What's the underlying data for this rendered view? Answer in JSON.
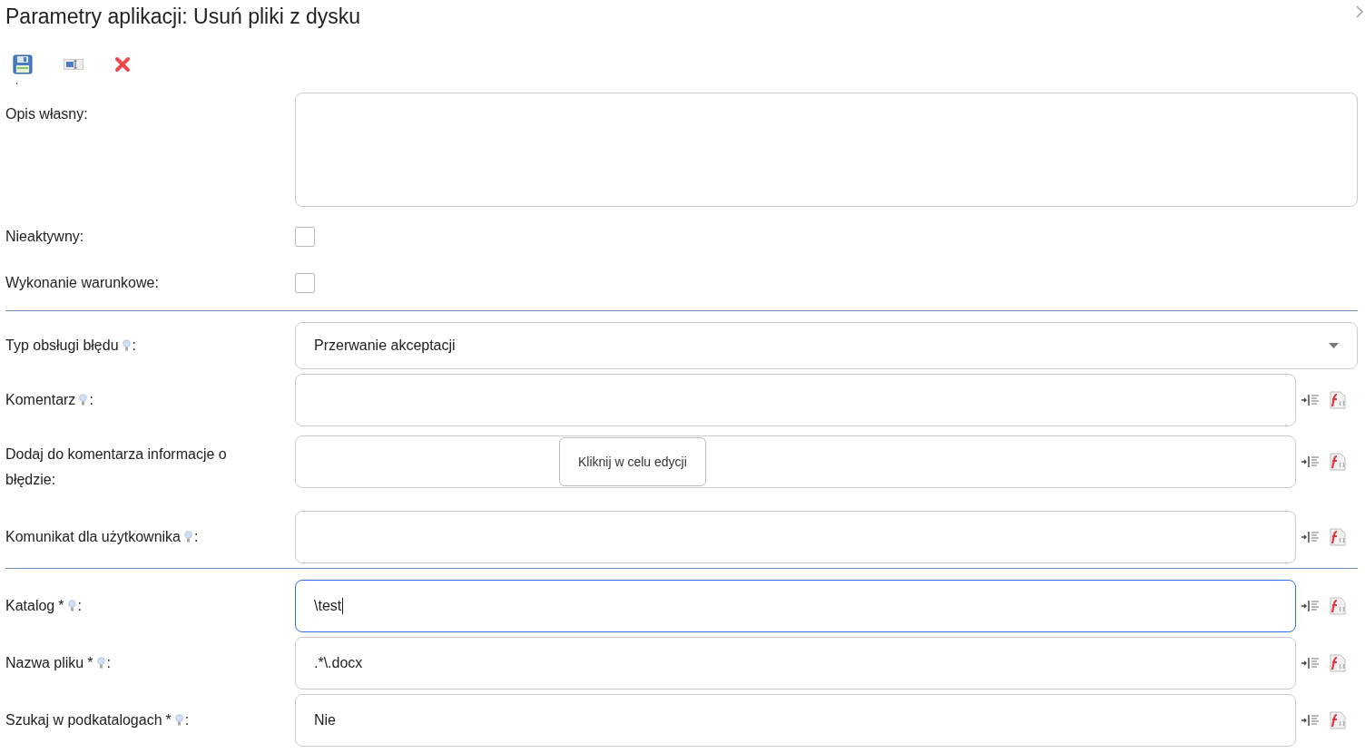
{
  "title": "Parametry aplikacji: Usuń pliki z dysku",
  "toolbar": [
    {
      "kind": "save"
    },
    {
      "kind": "field"
    },
    {
      "kind": "delete"
    }
  ],
  "marker": ".",
  "sections": [
    {
      "rows": [
        {
          "label": "Opis własny:",
          "kind": "textarea",
          "hint": false,
          "actions": false
        },
        {
          "label": "Nieaktywny:",
          "kind": "checkbox",
          "hint": false,
          "actions": false,
          "checked": false
        },
        {
          "label": "Wykonanie warunkowe:",
          "kind": "checkbox",
          "hint": false,
          "actions": false,
          "checked": false
        }
      ]
    },
    {
      "rows": [
        {
          "label": "Typ obsługi błędu",
          "kind": "select",
          "hint": true,
          "suffix": ":",
          "actions": false,
          "value": "Przerwanie akceptacji"
        },
        {
          "label": "Komentarz",
          "kind": "text",
          "hint": true,
          "suffix": ":",
          "actions": true,
          "focused": false
        },
        {
          "label": "Dodaj do komentarza informacje o błędzie:",
          "kind": "edit",
          "hint": false,
          "actions": true,
          "button": "Kliknij w celu edycji"
        },
        {
          "label": "Komunikat dla użytkownika",
          "kind": "text",
          "hint": true,
          "suffix": ":",
          "actions": true,
          "focused": false
        }
      ]
    },
    {
      "rows": [
        {
          "label": "Katalog",
          "mark": "*",
          "kind": "text",
          "hint": true,
          "suffix": ":",
          "actions": true,
          "focused": true,
          "value": "\\test"
        },
        {
          "label": "Nazwa pliku",
          "mark": "*",
          "kind": "text",
          "hint": true,
          "suffix": ":",
          "actions": true,
          "focused": false,
          "value": ".*\\.docx"
        },
        {
          "label": "Szukaj w podkatalogach",
          "mark": "*",
          "kind": "text",
          "hint": true,
          "suffix": ":",
          "actions": true,
          "focused": false,
          "value": "Nie"
        }
      ]
    }
  ]
}
